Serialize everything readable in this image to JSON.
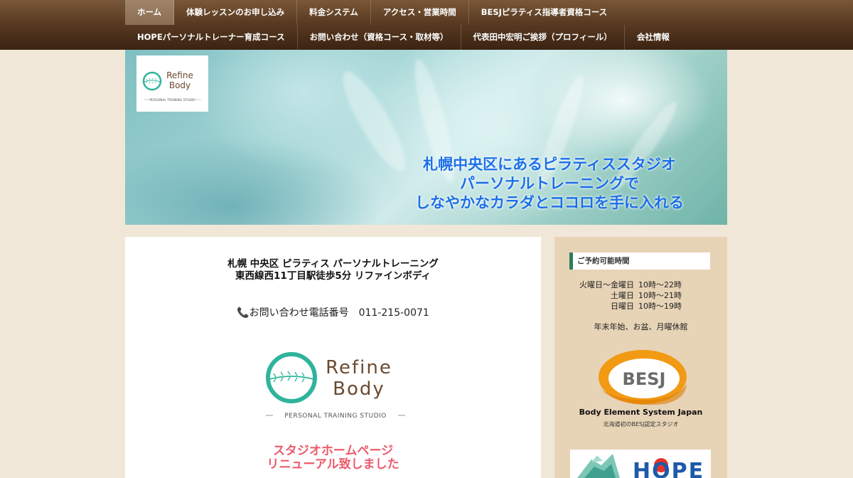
{
  "nav": {
    "row1": [
      "ホーム",
      "体験レッスンのお申し込み",
      "料金システム",
      "アクセス・営業時間",
      "BESJピラティス指導者資格コース"
    ],
    "row2": [
      "HOPEパーソナルトレーナー育成コース",
      "お問い合わせ（資格コース・取材等）",
      "代表田中宏明ご挨拶（プロフィール）",
      "会社情報"
    ],
    "active": "ホーム"
  },
  "hero": {
    "logo_line1": "Refine",
    "logo_line2": "Body",
    "logo_sub": "PERSONAL TRAINING STUDIO",
    "tagline": [
      "札幌中央区にあるピラティススタジオ",
      "パーソナルトレーニングで",
      "しなやかなカラダとココロを手に入れる"
    ]
  },
  "main": {
    "title_line1": "札幌 中央区 ピラティス パーソナルトレーニング",
    "title_line2": "東西線西11丁目駅徒歩5分 リファインボディ",
    "phone_icon": "📞",
    "phone_label": "お問い合わせ電話番号",
    "phone_number": "011-215-0071",
    "logo_line1": "Refine",
    "logo_line2": "Body",
    "logo_sub": "PERSONAL TRAINING STUDIO",
    "renewal_line1": "スタジオホームページ",
    "renewal_line2": "リニューアル致しました"
  },
  "sidebar": {
    "heading": "ご予約可能時間",
    "hours": [
      {
        "day": "火曜日〜金曜日",
        "time": "10時〜22時"
      },
      {
        "day": "土曜日",
        "time": "10時〜21時"
      },
      {
        "day": "日曜日",
        "time": "10時〜19時"
      }
    ],
    "holiday": "年末年始、お盆、月曜休館",
    "besj_mark": "BESJ",
    "besj_name": "Body Element System Japan",
    "besj_note": "北海道初のBESJ認定スタジオ",
    "hope_text": "HOPE"
  },
  "colors": {
    "nav_bg": "#5a3b22",
    "accent_green": "#2e7d5b",
    "logo_teal": "#2fb49b",
    "tagline_blue": "#1b6fe8",
    "renewal_pink": "#ee5a6c",
    "besj_orange": "#f29a14",
    "sidebar_bg": "#e7d3b6"
  }
}
